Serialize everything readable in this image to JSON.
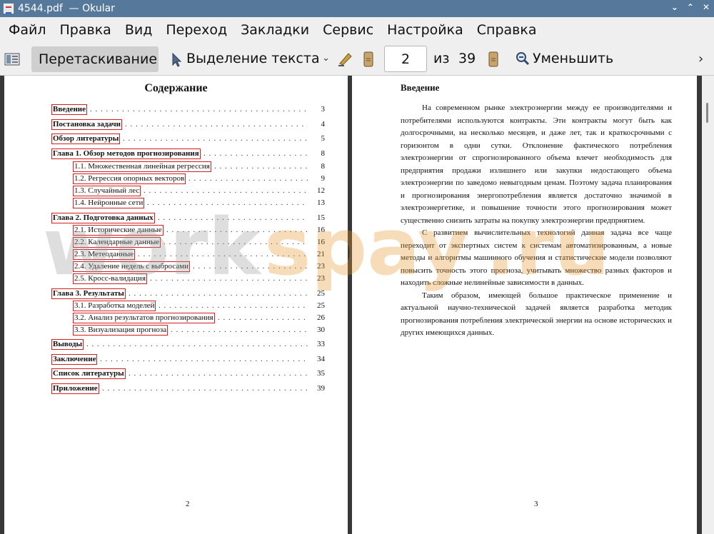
{
  "window": {
    "title": "4544.pdf  — Okular",
    "icon": "okular-app-icon",
    "controls": [
      "⌄",
      "⌃",
      "✕"
    ]
  },
  "menu": [
    "Файл",
    "Правка",
    "Вид",
    "Переход",
    "Закладки",
    "Сервис",
    "Настройка",
    "Справка"
  ],
  "toolbar": {
    "drag_label": "Перетаскивание",
    "select_label": "Выделение текста",
    "page_value": "2",
    "of_label": "из",
    "total_pages": "39",
    "zoom_out_label": "Уменьшить",
    "more": "›",
    "dropdown": "⌄"
  },
  "left_page": {
    "heading": "Содержание",
    "toc": [
      {
        "label": "Введение",
        "page": "3",
        "level": 1
      },
      {
        "label": "Постановка задачи",
        "page": "4",
        "level": 1
      },
      {
        "label": "Обзор литературы",
        "page": "5",
        "level": 1
      },
      {
        "label": "Глава 1.   Обзор методов прогнозирования",
        "page": "8",
        "level": 1
      },
      {
        "label": "1.1.   Множественная линейная регрессия",
        "page": "8",
        "level": 2
      },
      {
        "label": "1.2.   Регрессия опорных векторов",
        "page": "9",
        "level": 2
      },
      {
        "label": "1.3.   Случайный лес",
        "page": "12",
        "level": 2
      },
      {
        "label": "1.4.   Нейронные сети",
        "page": "13",
        "level": 2
      },
      {
        "label": "Глава 2.   Подготовка данных",
        "page": "15",
        "level": 1
      },
      {
        "label": "2.1.   Исторические данные",
        "page": "16",
        "level": 2
      },
      {
        "label": "2.2.   Календарные данные",
        "page": "16",
        "level": 2
      },
      {
        "label": "2.3.   Метеоданные",
        "page": "21",
        "level": 2
      },
      {
        "label": "2.4.   Удаление недель с выбросами",
        "page": "23",
        "level": 2
      },
      {
        "label": "2.5.   Кросс-валидация",
        "page": "23",
        "level": 2
      },
      {
        "label": "Глава 3.   Результаты",
        "page": "25",
        "level": 1
      },
      {
        "label": "3.1.   Разработка моделей",
        "page": "25",
        "level": 2
      },
      {
        "label": "3.2.   Анализ результатов прогнозирования",
        "page": "26",
        "level": 2
      },
      {
        "label": "3.3.   Визуализация прогноза",
        "page": "30",
        "level": 2
      },
      {
        "label": "Выводы",
        "page": "33",
        "level": 1
      },
      {
        "label": "Заключение",
        "page": "34",
        "level": 1
      },
      {
        "label": "Список литературы",
        "page": "35",
        "level": 1
      },
      {
        "label": "Приложение",
        "page": "39",
        "level": 1
      }
    ],
    "page_number": "2"
  },
  "right_page": {
    "heading": "Введение",
    "paragraphs": [
      "На современном рынке электроэнергии между ее производителями и потребителями используются контракты. Эти контракты могут быть как долгосрочными, на несколько месяцев, и даже лет, так и краткосрочными с горизонтом в одни сутки. Отклонение фактического потребления электроэнергии от спрогнозированного объема влечет необходимость для предприятия продажи излишнего или закупки недостающего объема электроэнергии по заведомо невыгодным ценам. Поэтому задача планирования и прогнозирования энергопотребления является достаточно значимой в электроэнергетике, и повышение точности этого прогнозирования может существенно снизить затраты на покупку электроэнергии предприятием.",
      "С развитием вычислительных технологий данная задача все чаще переходит от экспертных систем к системам автоматизированным, а новые методы и алгоритмы машинного обучения и статистические модели позволяют повысить точность этого прогноза, учитывать множество разных факторов и находить сложные нелинейные зависимости в данных.",
      "Таким образом, имеющей большое практическое применение и актуальной научно-технической задачей является разработка методик прогнозирования потребления электрической энергии на основе исторических и других имеющихся данных."
    ],
    "page_number": "3"
  },
  "watermark": {
    "part1": "work",
    "part2": "spay",
    "part3": ".ru",
    "color_gray": "#9a9a9a",
    "color_orange": "#e8962a"
  },
  "colors": {
    "titlebar": "#56789b",
    "link_box": "#d42020"
  }
}
